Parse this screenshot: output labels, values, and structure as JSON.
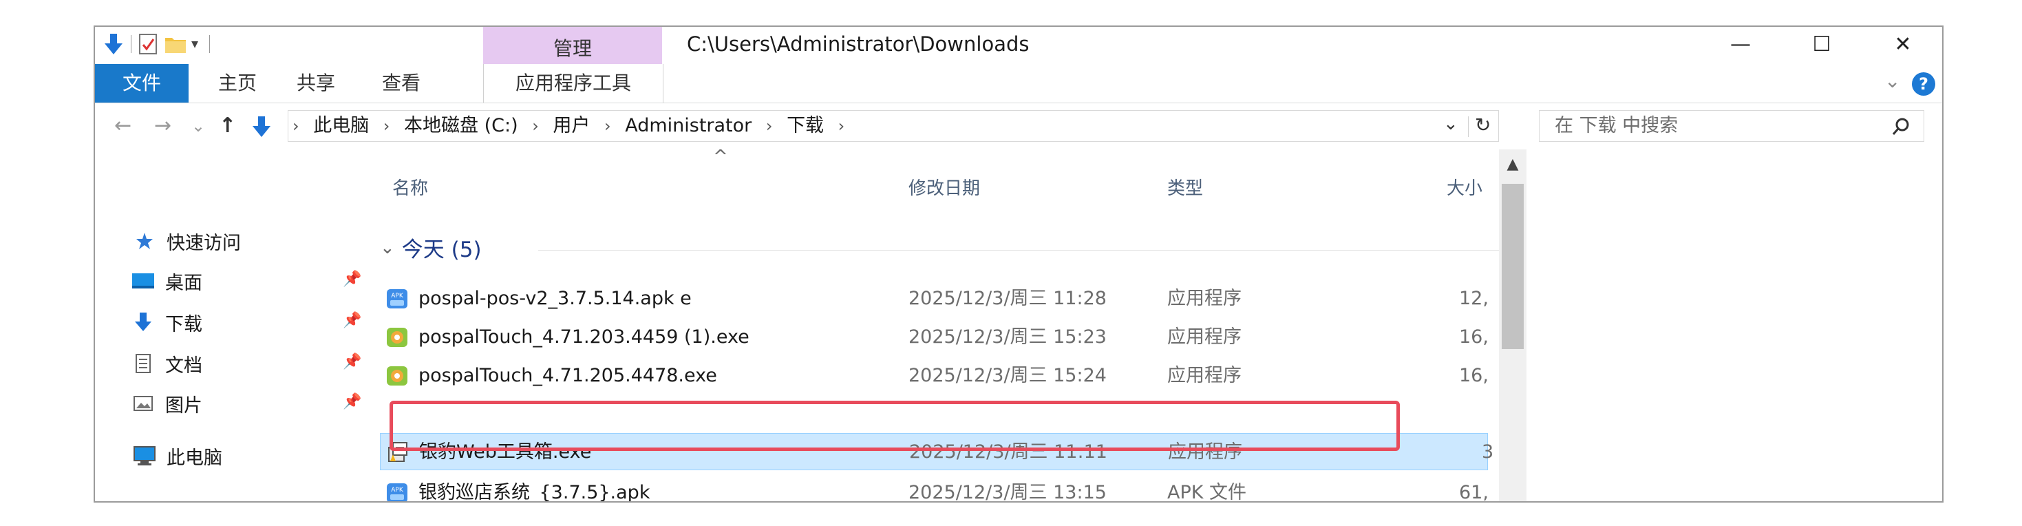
{
  "window": {
    "path_title": "C:\\Users\\Administrator\\Downloads",
    "context_group": "管理",
    "controls": {
      "minimize": "—",
      "maximize": "☐",
      "close": "✕"
    }
  },
  "ribbon": {
    "tabs": [
      "文件",
      "主页",
      "共享",
      "查看",
      "应用程序工具"
    ],
    "expand_glyph": "⌄",
    "help_glyph": "?"
  },
  "nav": {
    "back": "←",
    "forward": "→",
    "recent": "⌄",
    "up": "↑",
    "breadcrumbs": [
      "此电脑",
      "本地磁盘 (C:)",
      "用户",
      "Administrator",
      "下载"
    ],
    "separator": "›",
    "dropdown": "⌄",
    "refresh": "↻",
    "search_placeholder": "在 下载 中搜索",
    "search_glyph": "⚲"
  },
  "nav_pane": {
    "quick_access": "快速访问",
    "items": [
      {
        "label": "桌面",
        "icon": "desktop-folder-icon",
        "pinned": true
      },
      {
        "label": "下载",
        "icon": "download-arrow-icon",
        "pinned": true
      },
      {
        "label": "文档",
        "icon": "documents-icon",
        "pinned": true
      },
      {
        "label": "图片",
        "icon": "pictures-icon",
        "pinned": true
      }
    ],
    "this_pc": "此电脑",
    "pin_glyph": "📌"
  },
  "file_list": {
    "columns": [
      "名称",
      "修改日期",
      "类型",
      "大小"
    ],
    "sort_indicator": "^",
    "group": {
      "label": "今天 (5)",
      "chevron": "⌄"
    },
    "rows": [
      {
        "name": "pospal-pos-v2_3.7.5.14.apk   e",
        "date": "2025/12/3/周三 11:28",
        "type": "应用程序",
        "size": "12,",
        "icon": "apk-icon",
        "selected": false
      },
      {
        "name": "pospalTouch_4.71.203.4459 (1).exe",
        "date": "2025/12/3/周三 15:23",
        "type": "应用程序",
        "size": "16,",
        "icon": "pospal-app-icon",
        "selected": false
      },
      {
        "name": "pospalTouch_4.71.205.4478.exe",
        "date": "2025/12/3/周三 15:24",
        "type": "应用程序",
        "size": "16,",
        "icon": "pospal-app-icon",
        "selected": false
      },
      {
        "name": "银豹Web工具箱.exe",
        "date": "2025/12/3/周三 11:11",
        "type": "应用程序",
        "size": "3",
        "icon": "installer-icon",
        "selected": true
      },
      {
        "name": "银豹巡店系统_{3.7.5}.apk",
        "date": "2025/12/3/周三 13:15",
        "type": "APK 文件",
        "size": "61,",
        "icon": "apk-icon",
        "selected": false
      }
    ]
  },
  "colors": {
    "file_tab": "#1979ca",
    "manage_band": "#e6c9f1",
    "selection": "#cce8ff",
    "highlight_box": "#e84b5b",
    "group_header": "#1e3b88"
  }
}
